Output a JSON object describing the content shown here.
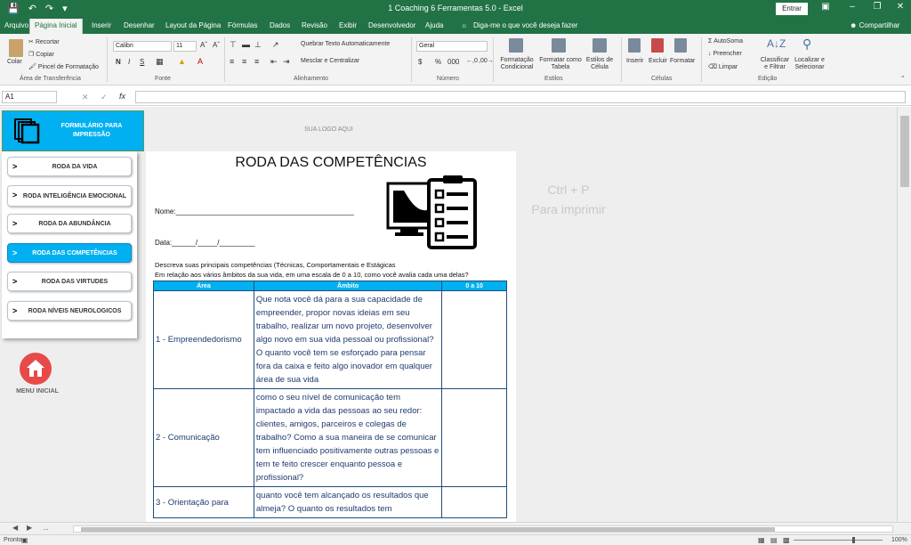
{
  "window": {
    "title": "1 Coaching 6 Ferramentas 5.0  -  Excel",
    "signin": "Entrar",
    "share": "Compartilhar"
  },
  "ribbon_tabs": [
    "Arquivo",
    "Página Inicial",
    "Inserir",
    "Desenhar",
    "Layout da Página",
    "Fórmulas",
    "Dados",
    "Revisão",
    "Exibir",
    "Desenvolvedor",
    "Ajuda"
  ],
  "tell_me": "Diga-me o que você deseja fazer",
  "ribbon": {
    "clipboard": {
      "paste": "Colar",
      "cut": "Recortar",
      "copy": "Copiar",
      "format_painter": "Pincel de Formatação",
      "label": "Área de Transferência"
    },
    "font": {
      "name": "Calibri",
      "size": "11",
      "bold": "N",
      "italic": "I",
      "underline": "S",
      "label": "Fonte"
    },
    "alignment": {
      "wrap": "Quebrar Texto Automaticamente",
      "merge": "Mesclar e Centralizar",
      "label": "Alinhamento"
    },
    "number": {
      "format": "Geral",
      "label": "Número"
    },
    "styles": {
      "conditional": "Formatação Condicional",
      "table": "Formatar como Tabela",
      "cell_styles": "Estilos de Célula",
      "label": "Estilos"
    },
    "cells": {
      "insert": "Inserir",
      "delete": "Excluir",
      "format": "Formatar",
      "label": "Células"
    },
    "editing": {
      "autosum": "AutoSoma",
      "fill": "Preencher",
      "clear": "Limpar",
      "sort": "Classificar e Filtrar",
      "find": "Localizar e Selecionar",
      "label": "Edição"
    }
  },
  "formula_bar": {
    "cell_ref": "A1",
    "content": ""
  },
  "sidebar": {
    "header": "FORMULÁRIO PARA IMPRESSÃO",
    "items": [
      {
        "label": "RODA DA VIDA",
        "active": false
      },
      {
        "label": "RODA INTELIGÊNCIA EMOCIONAL",
        "active": false
      },
      {
        "label": "RODA DA ABUNDÂNCIA",
        "active": false
      },
      {
        "label": "RODA DAS COMPETÊNCIAS",
        "active": true
      },
      {
        "label": "RODA DAS VIRTUDES",
        "active": false
      },
      {
        "label": "RODA NÍVEIS NEUROLOGICOS",
        "active": false
      }
    ],
    "home_label": "MENU INICIAL"
  },
  "logo_placeholder": "SUA LOGO AQUI",
  "form": {
    "title": "RODA DAS COMPETÊNCIAS",
    "name_field": "Nome:_____________________________________________",
    "date_field": "Data:______/_____/_________",
    "description_1": "Descreva suas principais competências (Técnicas, Comportamentais e Estágicas",
    "description_2": "Em relação aos vários âmbitos da sua vida, em uma escala de 0 a 10, como você avalia cada uma delas?",
    "table": {
      "headers": [
        "Área",
        "Âmbito",
        "0 a 10"
      ],
      "rows": [
        {
          "area": "1 - Empreendedorismo",
          "ambito": "Que nota você dá para a sua capacidade de empreender, propor novas ideias em seu trabalho, realizar um novo projeto, desenvolver algo novo em sua vida pessoal ou profissional? O quanto você tem se esforçado para pensar fora da caixa e feito algo inovador em qualquer área de sua vida",
          "score": ""
        },
        {
          "area": "2 - Comunicação",
          "ambito": "como o seu nível de comunicação tem impactado a vida das pessoas ao seu redor: clientes, amigos, parceiros e colegas de trabalho? Como a sua maneira de se comunicar tem influenciado positivamente outras pessoas e tem te feito crescer enquanto pessoa e profissional?",
          "score": ""
        },
        {
          "area": "3 - Orientação para",
          "ambito": "quanto você tem alcançado os resultados que almeja? O quanto os resultados tem",
          "score": ""
        }
      ]
    }
  },
  "print_hint": {
    "line1": "Ctrl + P",
    "line2": "Para imprimir"
  },
  "status": {
    "ready": "Pronto",
    "zoom": "100%",
    "zoom_level": 1.0
  }
}
